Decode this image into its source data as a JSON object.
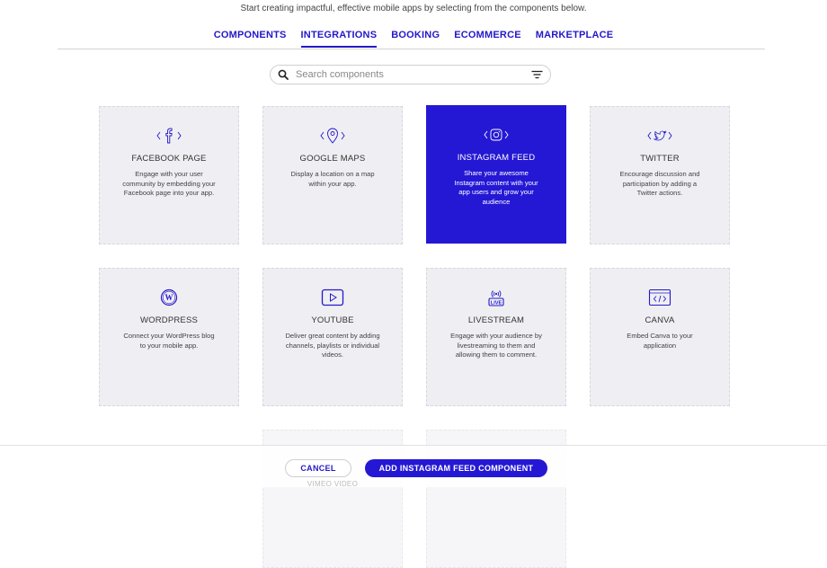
{
  "header": {
    "subtitle": "Start creating impactful, effective mobile apps by selecting from the components below."
  },
  "tabs": [
    {
      "label": "COMPONENTS",
      "active": false
    },
    {
      "label": "INTEGRATIONS",
      "active": true
    },
    {
      "label": "BOOKING",
      "active": false
    },
    {
      "label": "ECOMMERCE",
      "active": false
    },
    {
      "label": "MARKETPLACE",
      "active": false
    }
  ],
  "search": {
    "placeholder": "Search components",
    "value": ""
  },
  "cards": [
    {
      "title": "FACEBOOK PAGE",
      "description": "Engage with your user community by embedding your Facebook page into your app.",
      "icon": "facebook-icon",
      "selected": false
    },
    {
      "title": "GOOGLE MAPS",
      "description": "Display a location on a map within your app.",
      "icon": "map-pin-icon",
      "selected": false
    },
    {
      "title": "INSTAGRAM FEED",
      "description": "Share your awesome Instagram content with your app users and grow your audience",
      "icon": "instagram-icon",
      "selected": true
    },
    {
      "title": "TWITTER",
      "description": "Encourage discussion and participation by adding a Twitter actions.",
      "icon": "twitter-icon",
      "selected": false
    },
    {
      "title": "WORDPRESS",
      "description": "Connect your WordPress blog to your mobile app.",
      "icon": "wordpress-icon",
      "selected": false
    },
    {
      "title": "YOUTUBE",
      "description": "Deliver great content by adding channels, playlists or individual videos.",
      "icon": "youtube-icon",
      "selected": false
    },
    {
      "title": "LIVESTREAM",
      "description": "Engage with your audience by livestreaming to them and allowing them to comment.",
      "icon": "livestream-icon",
      "selected": false
    },
    {
      "title": "CANVA",
      "description": "Embed Canva to your application",
      "icon": "canva-code-icon",
      "selected": false
    }
  ],
  "partial_cards": [
    {
      "title": "VIMEO VIDEO"
    }
  ],
  "footer": {
    "cancel_label": "CANCEL",
    "add_label": "ADD INSTAGRAM FEED COMPONENT"
  },
  "colors": {
    "accent": "#2418d4",
    "card_bg": "#efeff3"
  }
}
